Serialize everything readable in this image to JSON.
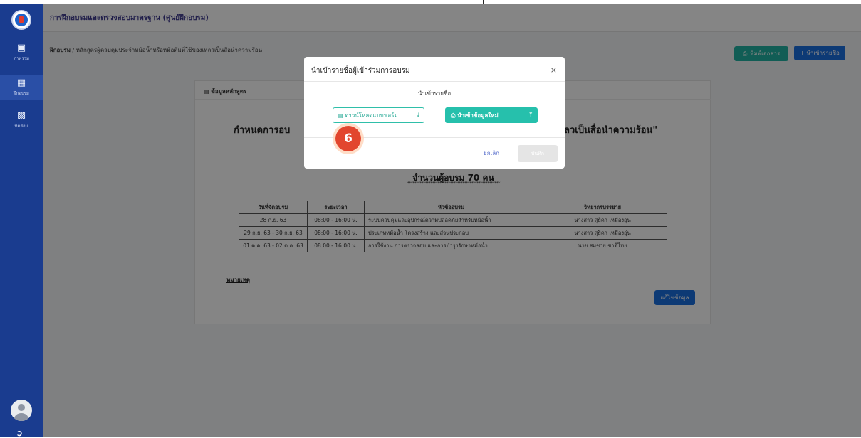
{
  "app": {
    "title": "การฝึกอบรมและตรวจสอบมาตรฐาน (ศูนย์ฝึกอบรม)"
  },
  "sidebar": {
    "items": [
      {
        "label": "ภาพรวม",
        "icon": "monitor-icon"
      },
      {
        "label": "ฝึกอบรม",
        "icon": "grid-icon",
        "active": true
      },
      {
        "label": "ทดสอบ",
        "icon": "building-icon"
      }
    ]
  },
  "breadcrumb": {
    "root": "ฝึกอบรม",
    "separator": " / ",
    "current": "หลักสูตรผู้ควบคุมประจำหม้อน้ำหรือหม้อต้มที่ใช้ของเหลวเป็นสื่อนำความร้อน"
  },
  "toolbar": {
    "print_label": "พิมพ์เอกสาร",
    "import_label": "+ นำเข้ารายชื่อ"
  },
  "card": {
    "header": "ข้อมูลหลักสูตร",
    "title_left": "กำหนดการอบ",
    "title_right": "ลวเป็นสื่อนำความร้อน\"",
    "participants": "จำนวนผู้อบรม 70 คน",
    "stars": "****************************************************",
    "table": {
      "headers": [
        "วันที่จัดอบรม",
        "ระยะเวลา",
        "หัวข้ออบรม",
        "วิทยากรบรรยาย"
      ],
      "rows": [
        [
          "28 ก.ย. 63",
          "08:00 - 16:00 น.",
          "ระบบควบคุมและอุปกรณ์ความปลอดภัยสำหรับหม้อน้ำ",
          "นางสาว สุธิดา เหมืองอุ่น"
        ],
        [
          "29 ก.ย. 63 - 30 ก.ย. 63",
          "08:00 - 16:00 น.",
          "ประเภทหม้อน้ำ โครงสร้าง และส่วนประกอบ",
          "นางสาว สุธิดา เหมืองอุ่น"
        ],
        [
          "01 ต.ค. 63 - 02 ต.ค. 63",
          "08:00 - 16:00 น.",
          "การใช้งาน การตรวจสอบ และการบำรุงรักษาหม้อน้ำ",
          "นาย สมชาย ชาติไทย"
        ]
      ]
    },
    "note_label": "หมายเหตุ",
    "edit_label": "แก้ไขข้อมูล"
  },
  "modal": {
    "title": "นำเข้ารายชื่อผู้เข้าร่วมการอบรม",
    "close": "×",
    "section_label": "นำเข้ารายชื่อ",
    "download_label": "ดาวน์โหลดแบบฟอร์ม",
    "import_new_label": "นำเข้าข้อมูลใหม่",
    "cancel_label": "ยกเลิก",
    "save_label": "บันทึก"
  },
  "step_badge": "6",
  "colors": {
    "sidebar": "#1a3c8f",
    "accent_teal": "#26c0ac",
    "accent_blue": "#1a6fe0",
    "badge": "#e2462e"
  }
}
